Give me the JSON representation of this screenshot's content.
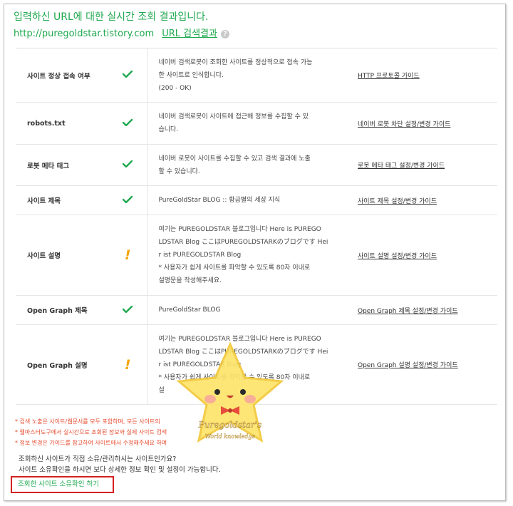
{
  "header": {
    "title": "입력하신 URL에 대한 실시간 조회 결과입니다.",
    "url": "http://puregoldstar.tistory.com",
    "search_link": "URL 검색결과",
    "help_glyph": "?"
  },
  "rows": [
    {
      "name": "사이트 정상 접속 여부",
      "status": "ok",
      "desc": [
        "네이버 검색로봇이 조회한 사이트를 정상적으로 접속 가능",
        "한 사이트로 인식합니다.",
        "(200 - OK)"
      ],
      "guide": "HTTP 프로토콜 가이드"
    },
    {
      "name": "robots.txt",
      "status": "ok",
      "desc": [
        "네이버 검색로봇이 사이트에 접근해 정보를 수집할 수 있",
        "습니다."
      ],
      "guide": "네이버 로봇 차단 설정/변경 가이드"
    },
    {
      "name": "로봇 메타 태그",
      "status": "ok",
      "desc": [
        "네이버 로봇이 사이트를 수집할 수 있고 검색 결과에 노출",
        "할 수 있습니다."
      ],
      "guide": "로봇 메타 태그 설정/변경 가이드"
    },
    {
      "name": "사이트 제목",
      "status": "ok",
      "desc": [
        "PureGoldStar BLOG :: 황금별의 세상 지식"
      ],
      "guide": "사이트 제목 설정/변경 가이드"
    },
    {
      "name": "사이트 설명",
      "status": "warning",
      "desc": [
        "여기는 PUREGOLDSTAR 블로그입니다 Here is PUREGO",
        "LDSTAR Blog ここはPUREGOLDSTARKのブログです Hei",
        "r ist PUREGOLDSTAR Blog",
        "* 사용자가 쉽게 사이트를 파악할 수 있도록 80자 이내로",
        "설명문을 작성해주세요."
      ],
      "guide": "사이트 설명 설정/변경 가이드"
    },
    {
      "name": "Open Graph 제목",
      "status": "ok",
      "desc": [
        "PureGoldStar BLOG"
      ],
      "guide": "Open Graph 제목 설정/변경 가이드"
    },
    {
      "name": "Open Graph 설명",
      "status": "warning",
      "desc": [
        "여기는 PUREGOLDSTAR 블로그입니다 Here is PUREGO",
        "LDSTAR Blog ここはPUREGOLDSTARKのブログです Hei",
        "r ist PUREGOLDSTAR Blog",
        "* 사용자가 쉽게 사이트를 파악할 수 있도록 80자 이내로",
        "설"
      ],
      "guide": "Open Graph 설명 설정/변경 가이드"
    }
  ],
  "notes": [
    "* 검색 노출은 사이트/웹문서를 모두 포함하며, 모든 사이트의",
    "* 웹마스터도구에서 실시간으로 조회된 정보와 실제 사이트 검색",
    "* 정보 변경은 가이드를 참고하여 사이트에서 수정해주세요 하며"
  ],
  "owner": {
    "question": "조회하신 사이트가 직접 소유/관리하시는 사이트인가요?",
    "hint": "사이트 소유확인을 하시면 보다 상세한 정보 확인 및 설정이 가능합니다.",
    "button": "조회한 사이트 소유확인 하기"
  },
  "watermark": {
    "line1": "Puregoldstar's",
    "line2": "World knowledge"
  },
  "colors": {
    "accent_green": "#1fa84f",
    "warning_orange": "#f5a300",
    "note_red": "#e64a2e",
    "highlight_red": "#d42121",
    "star_yellow": "#fde46a"
  }
}
